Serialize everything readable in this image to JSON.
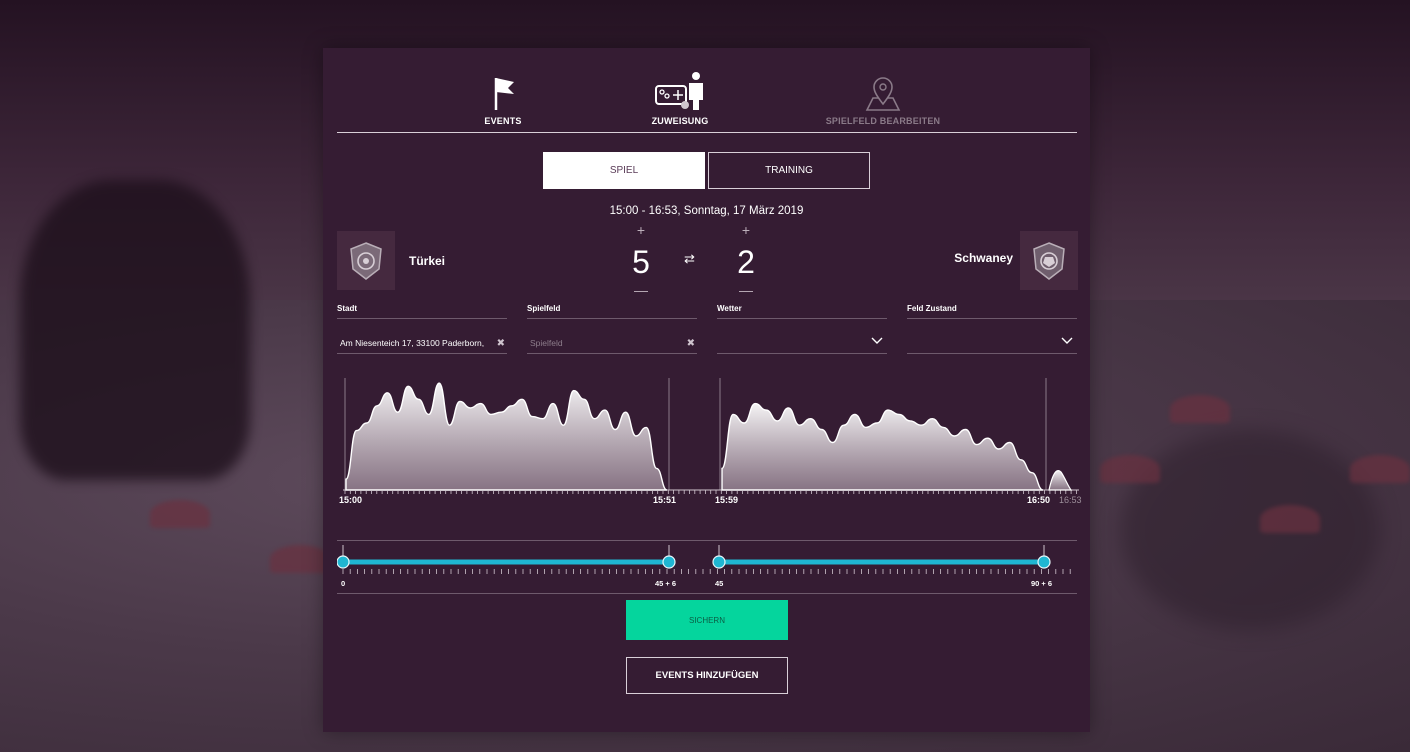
{
  "tabs": [
    {
      "label": "EVENTS",
      "icon": "flag-icon"
    },
    {
      "label": "ZUWEISUNG",
      "icon": "assign-player-icon"
    },
    {
      "label": "SPIELFELD BEARBEITEN",
      "icon": "map-pin-icon"
    }
  ],
  "mode": {
    "spiel": "SPIEL",
    "training": "TRAINING",
    "selected": "SPIEL"
  },
  "match": {
    "datetime": "15:00 - 16:53, Sonntag, 17 März 2019",
    "home": {
      "name": "Türkei",
      "score": "5"
    },
    "away": {
      "name": "Schwaney",
      "score": "2"
    },
    "plus": "+",
    "minus": "—",
    "swap": "⇄"
  },
  "fields": {
    "stadt": {
      "label": "Stadt",
      "value": "Am Niesenteich 17, 33100 Paderborn,"
    },
    "spielfeld": {
      "label": "Spielfeld",
      "placeholder": "Spielfeld"
    },
    "wetter": {
      "label": "Wetter",
      "value": ""
    },
    "feld_zustand": {
      "label": "Feld Zustand",
      "value": ""
    }
  },
  "chart_data": {
    "type": "area",
    "x_ticks": [
      "15:00",
      "15:51",
      "15:59",
      "16:50",
      "16:53"
    ],
    "series": [
      {
        "values": [
          10,
          55,
          62,
          78,
          90,
          72,
          96,
          84,
          70,
          99,
          60,
          82,
          76,
          80,
          70,
          72,
          78,
          84,
          68,
          66,
          80,
          60,
          92,
          84,
          66,
          74,
          56,
          72,
          50,
          58,
          20,
          0
        ]
      },
      {
        "values": [
          20,
          70,
          62,
          80,
          74,
          64,
          76,
          60,
          66,
          56,
          44,
          60,
          70,
          58,
          62,
          74,
          70,
          64,
          60,
          66,
          58,
          50,
          56,
          42,
          48,
          38,
          44,
          28,
          16,
          0
        ]
      }
    ]
  },
  "slider": {
    "first_half": {
      "start": "0",
      "end": "45 + 6"
    },
    "second_half": {
      "start": "45",
      "end": "90 + 6"
    },
    "accent": "#1fb6d2"
  },
  "buttons": {
    "save": "SICHERN",
    "add_events": "EVENTS HINZUFÜGEN"
  },
  "colors": {
    "panel": "#351c33",
    "save": "#05d59d",
    "accent": "#1fb6d2"
  }
}
